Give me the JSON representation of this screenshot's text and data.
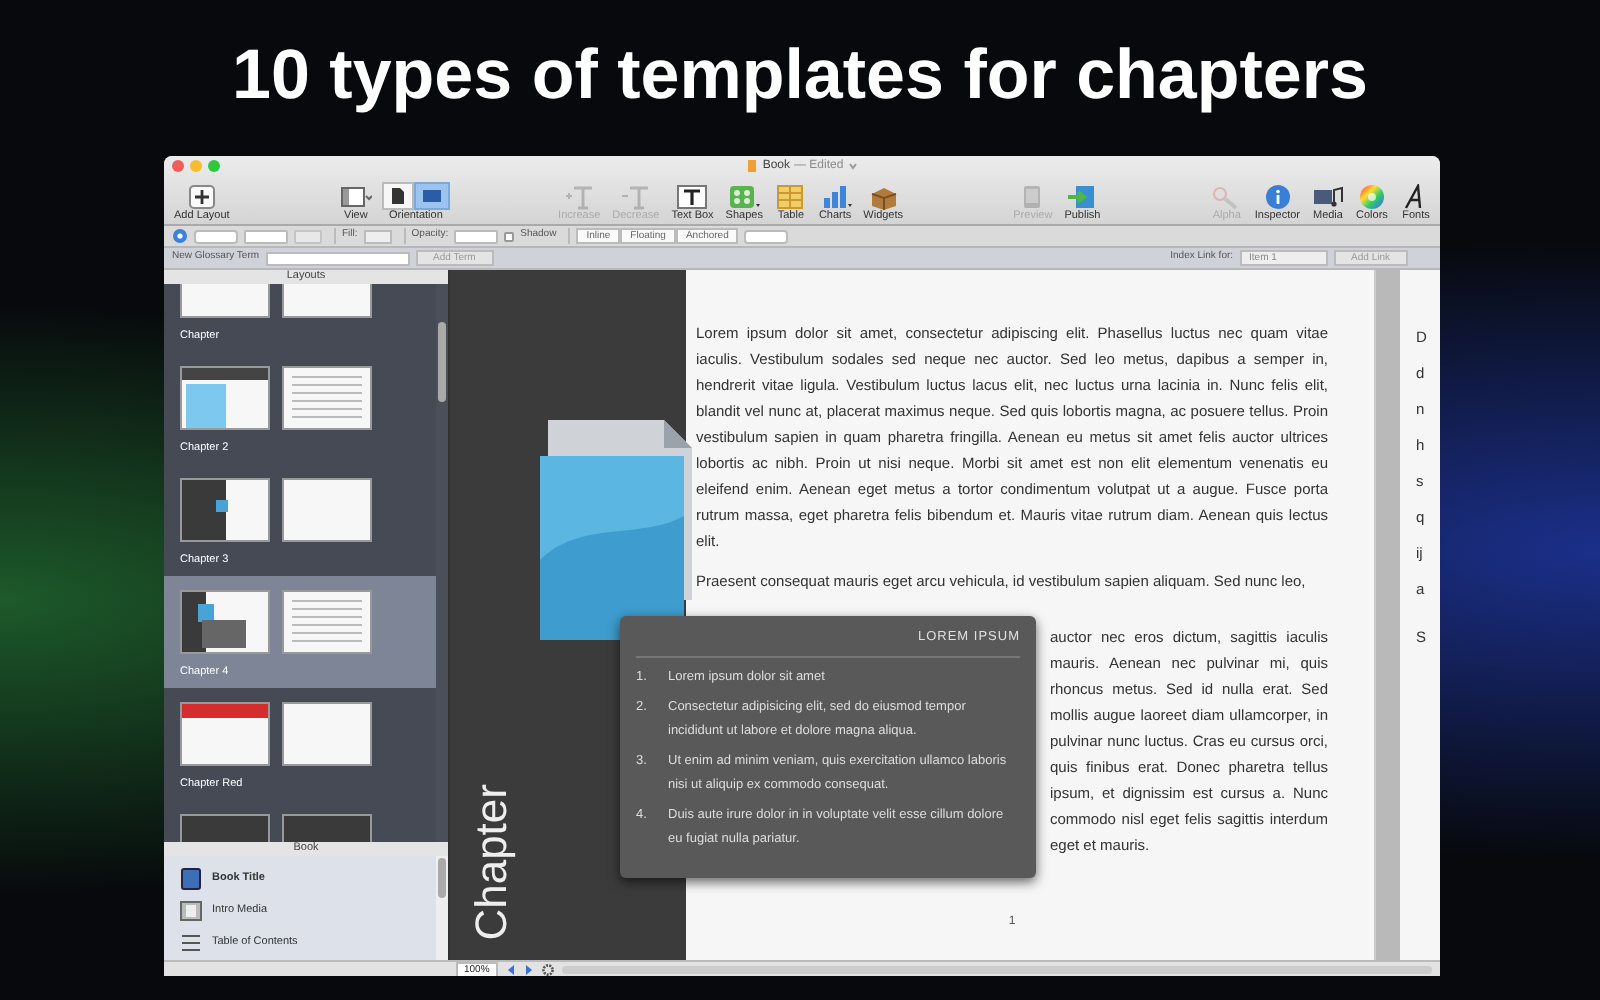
{
  "headline": "10 types of templates for chapters",
  "window": {
    "title": "Book",
    "status": "— Edited"
  },
  "toolbar": [
    [
      {
        "label": "Add Layout",
        "kind": "add",
        "disabled": false
      }
    ],
    [
      {
        "label": "View",
        "kind": "view",
        "disabled": false
      },
      {
        "label": "Orientation",
        "kind": "orientation",
        "options": [
          {
            "selected": false
          },
          {
            "selected": true
          }
        ]
      }
    ],
    [
      {
        "label": "Increase",
        "kind": "increase",
        "disabled": true
      },
      {
        "label": "Decrease",
        "kind": "decrease",
        "disabled": true
      },
      {
        "label": "Text Box",
        "kind": "textbox",
        "disabled": false
      },
      {
        "label": "Shapes",
        "kind": "shapes",
        "disabled": false
      },
      {
        "label": "Table",
        "kind": "table",
        "disabled": false
      },
      {
        "label": "Charts",
        "kind": "charts",
        "disabled": false
      },
      {
        "label": "Widgets",
        "kind": "widgets",
        "disabled": false
      }
    ],
    [
      {
        "label": "Preview",
        "kind": "preview",
        "disabled": true
      },
      {
        "label": "Publish",
        "kind": "publish",
        "disabled": false
      }
    ],
    [
      {
        "label": "Alpha",
        "kind": "alpha",
        "disabled": true
      },
      {
        "label": "Inspector",
        "kind": "inspector",
        "disabled": false
      },
      {
        "label": "Media",
        "kind": "media",
        "disabled": false
      },
      {
        "label": "Colors",
        "kind": "colors",
        "disabled": false
      },
      {
        "label": "Fonts",
        "kind": "fonts",
        "disabled": false
      }
    ]
  ],
  "format_bar": [
    [
      {
        "kind": "circle"
      },
      {
        "kind": "stepper"
      },
      {
        "kind": "select"
      },
      {
        "kind": "button"
      }
    ],
    [
      {
        "kind": "label",
        "text": "Fill:"
      },
      {
        "kind": "swatch"
      }
    ],
    [
      {
        "kind": "label",
        "text": "Opacity:"
      },
      {
        "kind": "select"
      },
      {
        "kind": "checkbox",
        "label": "Shadow",
        "checked": false
      }
    ],
    [
      {
        "kind": "segmented",
        "options": [
          "Inline",
          "Floating",
          "Anchored"
        ]
      },
      {
        "kind": "stepper"
      }
    ]
  ],
  "glossary_bar": {
    "term_label": "New Glossary Term",
    "add_term": {
      "label": "Add Term",
      "disabled": true
    },
    "index_label": "Index Link for:",
    "index_select": "Item 1",
    "add_link": {
      "label": "Add Link",
      "disabled": true
    }
  },
  "sidebar": {
    "layouts_title": "Layouts",
    "layouts": [
      {
        "label": "Chapter",
        "kind": "plain",
        "selected": false
      },
      {
        "label": "Chapter 2",
        "kind": "header-blue",
        "selected": false
      },
      {
        "label": "Chapter 3",
        "kind": "dark-side",
        "selected": false
      },
      {
        "label": "Chapter 4",
        "kind": "callout",
        "selected": true
      },
      {
        "label": "Chapter Red",
        "kind": "header-red",
        "selected": false
      },
      {
        "kind": "dark",
        "selected": false
      }
    ],
    "book_title": "Book",
    "book_items": [
      {
        "label": "Book Title",
        "kind": "book",
        "current": true
      },
      {
        "label": "Intro Media",
        "kind": "media",
        "current": false
      },
      {
        "label": "Table of Contents",
        "kind": "toc",
        "current": false
      }
    ]
  },
  "page": {
    "chapter_label": "Chapter",
    "paragraphs": [
      "Lorem ipsum dolor sit amet, consectetur adipiscing elit. Phasellus luctus nec quam vitae iaculis. Vestibulum sodales sed neque nec auctor. Sed leo metus, dapibus a semper in, hendrerit vitae ligula. Vestibulum luctus lacus elit, nec luctus urna lacinia in. Nunc felis elit, blandit vel nunc at, placerat maximus neque. Sed quis lobortis magna, ac posuere tellus. Proin vestibulum sapien in quam pharetra fringilla. Aenean eu metus sit amet felis auctor ultrices lobortis ac nibh. Proin ut nisi neque. Morbi sit amet est non elit elementum venenatis eu eleifend enim. Aenean eget metus a tortor condimentum volutpat ut a augue. Fusce porta rutrum massa, eget pharetra felis bibendum et. Mauris vitae rutrum diam. Aenean quis lectus elit.",
      "Praesent consequat mauris eget arcu vehicula, id vestibulum sapien aliquam. Sed nunc leo,"
    ],
    "wrap_text": "auctor nec eros dictum, sagittis iaculis mauris. Aenean nec pulvinar mi, quis rhoncus metus. Sed id nulla erat. Sed mollis augue laoreet diam ullamcorper, in pulvinar nunc luctus. Cras eu cursus orci, quis finibus erat. Donec pharetra tellus ipsum, et dignissim est cursus a. Nunc commodo nisl eget felis sagittis interdum eget et mauris.",
    "callout": {
      "title": "LOREM IPSUM",
      "items": [
        {
          "number": "1.",
          "text": "Lorem ipsum dolor sit amet"
        },
        {
          "number": "2.",
          "text": "Consectetur adipisicing elit, sed do eiusmod tempor incididunt ut labore et dolore magna aliqua."
        },
        {
          "number": "3.",
          "text": "Ut enim ad minim veniam, quis exercitation ullamco laboris nisi ut aliquip ex commodo consequat."
        },
        {
          "number": "4.",
          "text": "Duis aute irure dolor in in voluptate velit esse cillum dolore eu fugiat nulla pariatur."
        }
      ]
    },
    "page_number": "1",
    "next_page_fragments": [
      [
        "D",
        "d",
        "n",
        "h",
        "s",
        "q",
        "ij",
        "a"
      ],
      [
        "S"
      ]
    ]
  },
  "status_bar": {
    "zoom": "100%"
  }
}
